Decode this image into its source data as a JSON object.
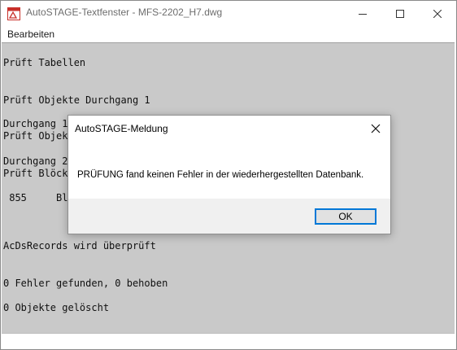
{
  "window": {
    "title": "AutoSTAGE-Textfenster - MFS-2202_H7.dwg",
    "icon": "autocad-text-window-icon",
    "controls": [
      "minimize-icon",
      "maximize-icon",
      "close-icon"
    ]
  },
  "menu": {
    "items": [
      "Bearbeiten"
    ]
  },
  "console": {
    "lines": [
      "Prüft Tabellen",
      "Prüft Objekte Durchgang 1",
      "Durchgang 1",
      "Prüft Objekt",
      "Durchgang 2",
      "Prüft Blöcke",
      " 855     Blö",
      "AcDsRecords wird überprüft",
      "0 Fehler gefunden, 0 behoben",
      "0 Objekte gelöscht"
    ]
  },
  "dialog": {
    "title": "AutoSTAGE-Meldung",
    "message": "PRÜFUNG fand keinen Fehler in der wiederhergestellten Datenbank.",
    "ok_label": "OK"
  },
  "colors": {
    "console_background": "#c9c9c9",
    "accent": "#0078d7"
  }
}
